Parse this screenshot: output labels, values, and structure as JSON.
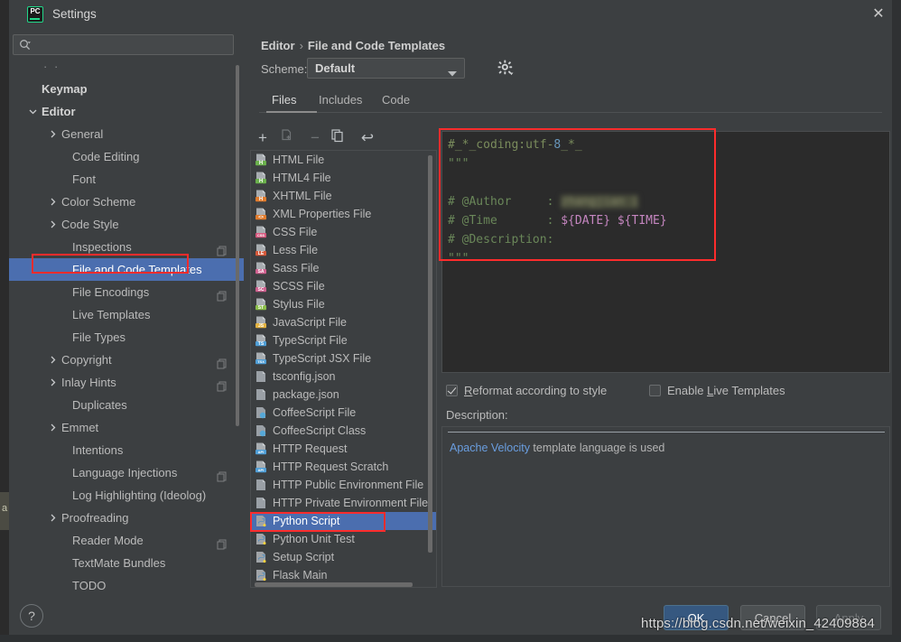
{
  "window": {
    "title": "Settings",
    "logo_text": "PC",
    "close_icon": "✕"
  },
  "search": {
    "placeholder": "",
    "value": "",
    "icon": "search-icon"
  },
  "sidebar": {
    "scroll_dots": "· ·",
    "items": [
      {
        "label": "Keymap",
        "indent": 18,
        "chevron": "none",
        "bold": true,
        "selected": false,
        "badge": false
      },
      {
        "label": "Editor",
        "indent": 18,
        "chevron": "down",
        "bold": true,
        "selected": false,
        "badge": false
      },
      {
        "label": "General",
        "indent": 40,
        "chevron": "right",
        "bold": false,
        "selected": false,
        "badge": false
      },
      {
        "label": "Code Editing",
        "indent": 52,
        "chevron": "none",
        "bold": false,
        "selected": false,
        "badge": false
      },
      {
        "label": "Font",
        "indent": 52,
        "chevron": "none",
        "bold": false,
        "selected": false,
        "badge": false
      },
      {
        "label": "Color Scheme",
        "indent": 40,
        "chevron": "right",
        "bold": false,
        "selected": false,
        "badge": false
      },
      {
        "label": "Code Style",
        "indent": 40,
        "chevron": "right",
        "bold": false,
        "selected": false,
        "badge": false
      },
      {
        "label": "Inspections",
        "indent": 52,
        "chevron": "none",
        "bold": false,
        "selected": false,
        "badge": true
      },
      {
        "label": "File and Code Templates",
        "indent": 52,
        "chevron": "none",
        "bold": false,
        "selected": true,
        "badge": false
      },
      {
        "label": "File Encodings",
        "indent": 52,
        "chevron": "none",
        "bold": false,
        "selected": false,
        "badge": true
      },
      {
        "label": "Live Templates",
        "indent": 52,
        "chevron": "none",
        "bold": false,
        "selected": false,
        "badge": false
      },
      {
        "label": "File Types",
        "indent": 52,
        "chevron": "none",
        "bold": false,
        "selected": false,
        "badge": false
      },
      {
        "label": "Copyright",
        "indent": 40,
        "chevron": "right",
        "bold": false,
        "selected": false,
        "badge": true
      },
      {
        "label": "Inlay Hints",
        "indent": 40,
        "chevron": "right",
        "bold": false,
        "selected": false,
        "badge": true
      },
      {
        "label": "Duplicates",
        "indent": 52,
        "chevron": "none",
        "bold": false,
        "selected": false,
        "badge": false
      },
      {
        "label": "Emmet",
        "indent": 40,
        "chevron": "right",
        "bold": false,
        "selected": false,
        "badge": false
      },
      {
        "label": "Intentions",
        "indent": 52,
        "chevron": "none",
        "bold": false,
        "selected": false,
        "badge": false
      },
      {
        "label": "Language Injections",
        "indent": 52,
        "chevron": "none",
        "bold": false,
        "selected": false,
        "badge": true
      },
      {
        "label": "Log Highlighting (Ideolog)",
        "indent": 52,
        "chevron": "none",
        "bold": false,
        "selected": false,
        "badge": false
      },
      {
        "label": "Proofreading",
        "indent": 40,
        "chevron": "right",
        "bold": false,
        "selected": false,
        "badge": false
      },
      {
        "label": "Reader Mode",
        "indent": 52,
        "chevron": "none",
        "bold": false,
        "selected": false,
        "badge": true
      },
      {
        "label": "TextMate Bundles",
        "indent": 52,
        "chevron": "none",
        "bold": false,
        "selected": false,
        "badge": false
      },
      {
        "label": "TODO",
        "indent": 52,
        "chevron": "none",
        "bold": false,
        "selected": false,
        "badge": false
      }
    ]
  },
  "content": {
    "breadcrumb": {
      "parent": "Editor",
      "separator": "›",
      "current": "File and Code Templates"
    },
    "scheme": {
      "label": "Scheme:",
      "value": "Default",
      "gear_icon": "gear-icon"
    },
    "tabs": [
      {
        "label": "Files",
        "active": true
      },
      {
        "label": "Includes",
        "active": false
      },
      {
        "label": "Code",
        "active": false
      }
    ],
    "list_toolbar": [
      {
        "name": "add-button",
        "glyph": "+",
        "enabled": true
      },
      {
        "name": "copy-template-button",
        "glyph": "copy",
        "enabled": false
      },
      {
        "name": "remove-button",
        "glyph": "−",
        "enabled": false
      },
      {
        "name": "duplicate-button",
        "glyph": "pages",
        "enabled": true
      },
      {
        "name": "reset-button",
        "glyph": "↩",
        "enabled": true
      }
    ],
    "templates": [
      {
        "label": "HTML File",
        "icon": "html-file-icon",
        "selected": false
      },
      {
        "label": "HTML4 File",
        "icon": "html-file-icon",
        "selected": false
      },
      {
        "label": "XHTML File",
        "icon": "xhtml-file-icon",
        "selected": false
      },
      {
        "label": "XML Properties File",
        "icon": "xml-file-icon",
        "selected": false
      },
      {
        "label": "CSS File",
        "icon": "css-file-icon",
        "selected": false
      },
      {
        "label": "Less File",
        "icon": "less-file-icon",
        "selected": false
      },
      {
        "label": "Sass File",
        "icon": "sass-file-icon",
        "selected": false
      },
      {
        "label": "SCSS File",
        "icon": "scss-file-icon",
        "selected": false
      },
      {
        "label": "Stylus File",
        "icon": "stylus-file-icon",
        "selected": false
      },
      {
        "label": "JavaScript File",
        "icon": "javascript-file-icon",
        "selected": false
      },
      {
        "label": "TypeScript File",
        "icon": "typescript-file-icon",
        "selected": false
      },
      {
        "label": "TypeScript JSX File",
        "icon": "typescript-jsx-file-icon",
        "selected": false
      },
      {
        "label": "tsconfig.json",
        "icon": "json-file-icon",
        "selected": false
      },
      {
        "label": "package.json",
        "icon": "json-file-icon",
        "selected": false
      },
      {
        "label": "CoffeeScript File",
        "icon": "coffeescript-icon",
        "selected": false
      },
      {
        "label": "CoffeeScript Class",
        "icon": "coffeescript-icon",
        "selected": false
      },
      {
        "label": "HTTP Request",
        "icon": "http-request-icon",
        "selected": false
      },
      {
        "label": "HTTP Request Scratch",
        "icon": "http-request-icon",
        "selected": false
      },
      {
        "label": "HTTP Public Environment File",
        "icon": "json-file-icon",
        "selected": false
      },
      {
        "label": "HTTP Private Environment File",
        "icon": "json-file-icon",
        "selected": false
      },
      {
        "label": "Python Script",
        "icon": "python-file-icon",
        "selected": true
      },
      {
        "label": "Python Unit Test",
        "icon": "python-file-icon",
        "selected": false
      },
      {
        "label": "Setup Script",
        "icon": "python-file-icon",
        "selected": false
      },
      {
        "label": "Flask Main",
        "icon": "python-file-icon",
        "selected": false
      }
    ],
    "editor_code": {
      "line1_hash": "#_*_coding:utf-",
      "line1_num": "8",
      "line1_tail": "_*_",
      "line2": "\"\"\"",
      "line4_label": "# @Author     : ",
      "line4_value_blurred": "zhangjian i",
      "line5_label": "# @Time       : ",
      "line5_value": "${DATE} ${TIME}",
      "line6": "# @Description:",
      "line7": "\"\"\""
    },
    "options": {
      "reformat": {
        "label_pre": "R",
        "label_post": "eformat according to style",
        "checked": true
      },
      "live_templates": {
        "label_pre": "Enable ",
        "label_mid": "L",
        "label_post": "ive Templates",
        "checked": false
      }
    },
    "description": {
      "label": "Description:",
      "link_text": "Apache Velocity",
      "body_text": " template language is used"
    }
  },
  "footer": {
    "help_glyph": "?",
    "buttons": [
      {
        "label": "OK",
        "style": "primary"
      },
      {
        "label": "Cancel",
        "style": "normal"
      },
      {
        "label": "Apply",
        "style": "disabled"
      }
    ],
    "watermark": "https://blog.csdn.net/weixin_42409884"
  },
  "colors": {
    "selection_blue": "#4b6eaf",
    "highlight_red": "#fd2c2c",
    "panel_bg": "#3c3f41",
    "editor_bg": "#2b2b2b",
    "accent_green": "#21d789"
  }
}
